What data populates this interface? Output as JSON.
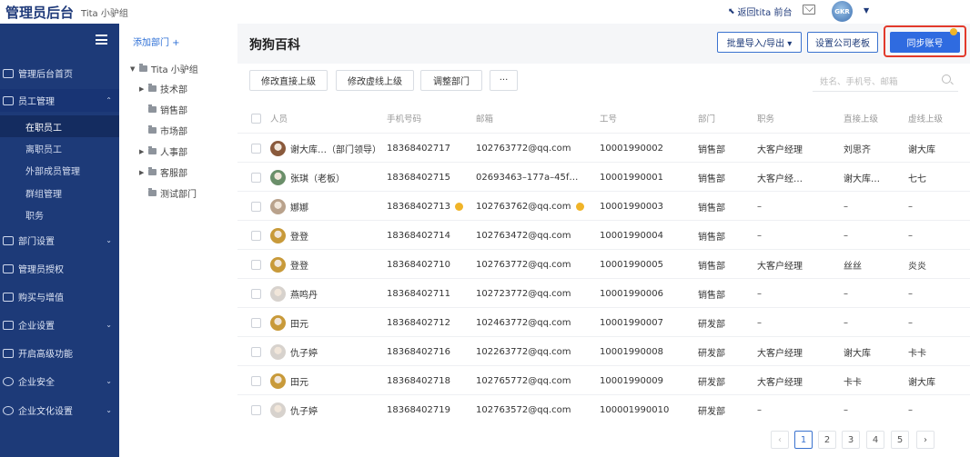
{
  "top": {
    "brand": "管理员后台",
    "org": "Tita 小驴组",
    "back_link": "返回tita 前台",
    "avatar_text": "GKR"
  },
  "sidebar": {
    "items": [
      {
        "label": "管理后台首页"
      },
      {
        "label": "员工管理",
        "expanded": true
      },
      {
        "label": "部门设置"
      },
      {
        "label": "管理员授权"
      },
      {
        "label": "购买与增值"
      },
      {
        "label": "企业设置"
      },
      {
        "label": "开启高级功能"
      },
      {
        "label": "企业安全"
      },
      {
        "label": "企业文化设置"
      }
    ],
    "sub_items": [
      {
        "label": "在职员工",
        "active": true
      },
      {
        "label": "离职员工"
      },
      {
        "label": "外部成员管理"
      },
      {
        "label": "群组管理"
      },
      {
        "label": "职务"
      }
    ]
  },
  "tree": {
    "add_label": "添加部门 +",
    "nodes": [
      {
        "label": "Tita 小驴组"
      },
      {
        "label": "技术部"
      },
      {
        "label": "销售部"
      },
      {
        "label": "市场部"
      },
      {
        "label": "人事部"
      },
      {
        "label": "客服部"
      },
      {
        "label": "测试部门"
      }
    ]
  },
  "main": {
    "title": "狗狗百科",
    "buttons": {
      "import_export": "批量导入/导出 ▾",
      "set_boss": "设置公司老板",
      "sync": "同步账号"
    },
    "actions": {
      "direct": "修改直接上级",
      "dotted": "修改虚线上级",
      "dept": "调整部门",
      "more": "···"
    },
    "search_placeholder": "姓名、手机号、邮箱",
    "columns": [
      "人员",
      "手机号码",
      "邮箱",
      "工号",
      "部门",
      "职务",
      "直接上级",
      "虚线上级"
    ],
    "rows": [
      {
        "name": "谢大库…（部门领导）",
        "phone": "18368402717",
        "email": "102763772@qq.com",
        "id": "10001990002",
        "dept": "销售部",
        "title": "大客户经理",
        "direct": "刘思齐",
        "dotted": "谢大库",
        "av": "#8a5a3c"
      },
      {
        "name": "张琪（老板）",
        "phone": "18368402715",
        "email": "02693463–177a–45f…",
        "id": "10001990001",
        "dept": "销售部",
        "title": "大客户经…",
        "direct": "谢大库…",
        "dotted": "七七",
        "av": "#6b8f6a"
      },
      {
        "name": "娜娜",
        "phone": "18368402713",
        "email": "102763762@qq.com",
        "id": "10001990003",
        "dept": "销售部",
        "title": "–",
        "direct": "–",
        "dotted": "–",
        "av": "#b9a28c",
        "warn": true
      },
      {
        "name": "登登",
        "phone": "18368402714",
        "email": "102763472@qq.com",
        "id": "10001990004",
        "dept": "销售部",
        "title": "–",
        "direct": "–",
        "dotted": "–",
        "av": "#c89a3a"
      },
      {
        "name": "登登",
        "phone": "18368402710",
        "email": "102763772@qq.com",
        "id": "10001990005",
        "dept": "销售部",
        "title": "大客户经理",
        "direct": "丝丝",
        "dotted": "炎炎",
        "av": "#c89a3a"
      },
      {
        "name": "燕鸣丹",
        "phone": "18368402711",
        "email": "102723772@qq.com",
        "id": "10001990006",
        "dept": "销售部",
        "title": "–",
        "direct": "–",
        "dotted": "–",
        "av": "#d7d2cd"
      },
      {
        "name": "田元",
        "phone": "18368402712",
        "email": "102463772@qq.com",
        "id": "10001990007",
        "dept": "研发部",
        "title": "–",
        "direct": "–",
        "dotted": "–",
        "av": "#c89a3a"
      },
      {
        "name": "仇子婷",
        "phone": "18368402716",
        "email": "102263772@qq.com",
        "id": "10001990008",
        "dept": "研发部",
        "title": "大客户经理",
        "direct": "谢大库",
        "dotted": "卡卡",
        "av": "#d7d2cd"
      },
      {
        "name": "田元",
        "phone": "18368402718",
        "email": "102765772@qq.com",
        "id": "10001990009",
        "dept": "研发部",
        "title": "大客户经理",
        "direct": "卡卡",
        "dotted": "谢大库",
        "av": "#c89a3a"
      },
      {
        "name": "仇子婷",
        "phone": "18368402719",
        "email": "102763572@qq.com",
        "id": "100001990010",
        "dept": "研发部",
        "title": "–",
        "direct": "–",
        "dotted": "–",
        "av": "#d7d2cd"
      }
    ],
    "pagination": {
      "prev": "‹",
      "pages": [
        "1",
        "2",
        "3",
        "4",
        "5"
      ],
      "current": "1",
      "next": "›"
    }
  }
}
